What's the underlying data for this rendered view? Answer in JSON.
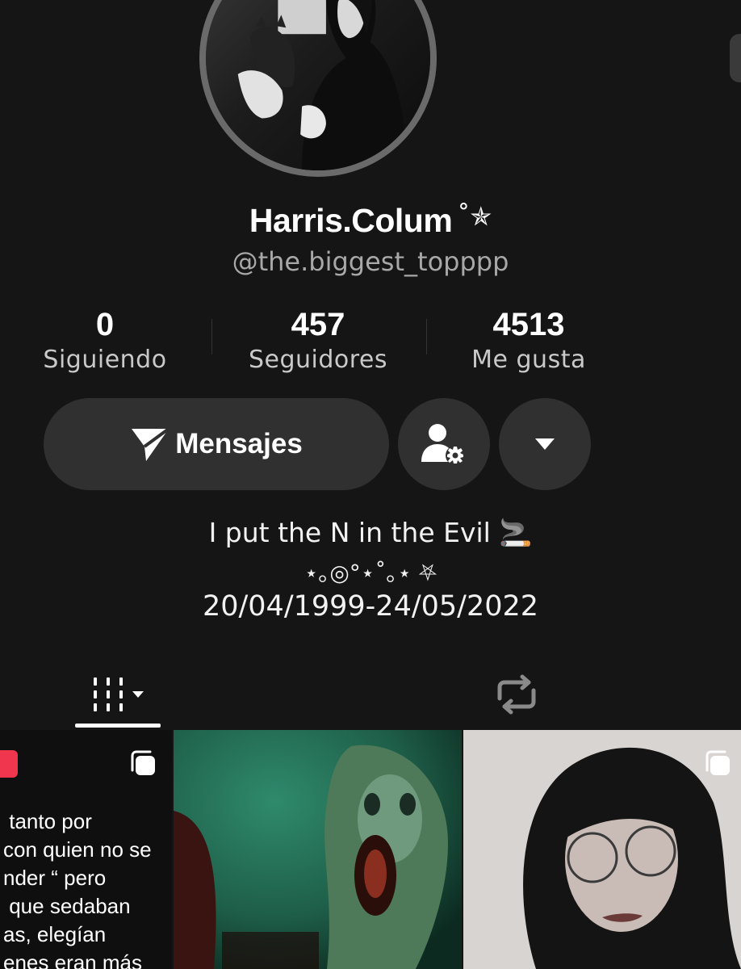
{
  "profile": {
    "display_name": "Harris.Colum",
    "name_decoration": "˚✯",
    "handle": "@the.biggest_topppp",
    "avatar_icon": "profile-photo"
  },
  "stats": [
    {
      "value": "0",
      "label": "Siguiendo"
    },
    {
      "value": "457",
      "label": "Seguidores"
    },
    {
      "value": "4513",
      "label": "Me gusta"
    }
  ],
  "actions": {
    "message_label": "Mensajes",
    "message_icon": "send-icon",
    "friends_icon": "user-settings-icon",
    "more_icon": "caret-down-icon"
  },
  "bio": {
    "line1": "I put the N in the Evil 🚬",
    "line2": "⋆｡◎°⋆˚｡⋆ ⛧",
    "line3": "20/04/1999-24/05/2022"
  },
  "tabs": [
    {
      "name": "videos",
      "icon": "grid-icon"
    },
    {
      "name": "reposts",
      "icon": "repost-icon"
    }
  ],
  "grid": [
    {
      "type": "text-post",
      "text": " tanto por\ncon quien no se\nnder “ pero\n que sedaban\nas, elegían\nenes eran más"
    },
    {
      "type": "image"
    },
    {
      "type": "image"
    }
  ],
  "colors": {
    "background": "#151515",
    "button_bg": "#303030",
    "accent_red": "#f0354f",
    "muted_text": "#a8a8a8"
  }
}
